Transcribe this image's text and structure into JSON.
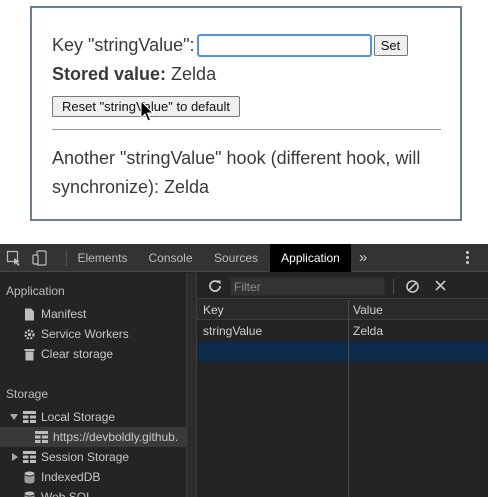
{
  "page": {
    "key_label": "Key \"stringValue\":",
    "input_value": "",
    "set_button": "Set",
    "stored_label": "Stored value:",
    "stored_value": "Zelda",
    "reset_button": "Reset \"stringValue\" to default",
    "another_text": "Another \"stringValue\" hook (different hook, will synchronize): Zelda"
  },
  "devtools": {
    "tabs": [
      {
        "label": "Elements",
        "active": false
      },
      {
        "label": "Console",
        "active": false
      },
      {
        "label": "Sources",
        "active": false
      },
      {
        "label": "Application",
        "active": true
      }
    ],
    "more_tabs": "»",
    "sidebar": {
      "application_heading": "Application",
      "application_items": [
        "Manifest",
        "Service Workers",
        "Clear storage"
      ],
      "storage_heading": "Storage",
      "local_storage": "Local Storage",
      "local_storage_origin": "https://devboldly.github.",
      "session_storage": "Session Storage",
      "indexeddb": "IndexedDB",
      "websql": "Web SQL"
    },
    "toolbar": {
      "filter_placeholder": "Filter"
    },
    "table": {
      "headers": [
        "Key",
        "Value"
      ],
      "rows": [
        {
          "key": "stringValue",
          "value": "Zelda"
        }
      ]
    }
  },
  "colors": {
    "active_tab_bg": "#000000",
    "devtools_bg": "#242424",
    "selected_row_bg": "#0c2a4a",
    "card_border": "#6a7f8f"
  }
}
